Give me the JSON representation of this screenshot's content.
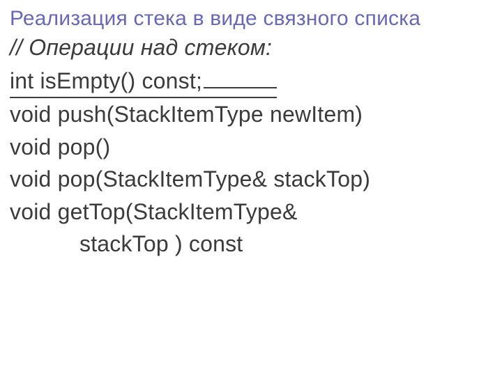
{
  "title": "Реализация стека в виде связного списка",
  "comment": "// Операции над стеком:",
  "code": {
    "l1": "int isEmpty() const;",
    "l2": "void push(StackItemType newItem)",
    "l3": "void pop()",
    "l4": "void pop(StackItemType& stackTop)",
    "l5": "void getTop(StackItemType&",
    "l6": "stackTop ) const"
  }
}
